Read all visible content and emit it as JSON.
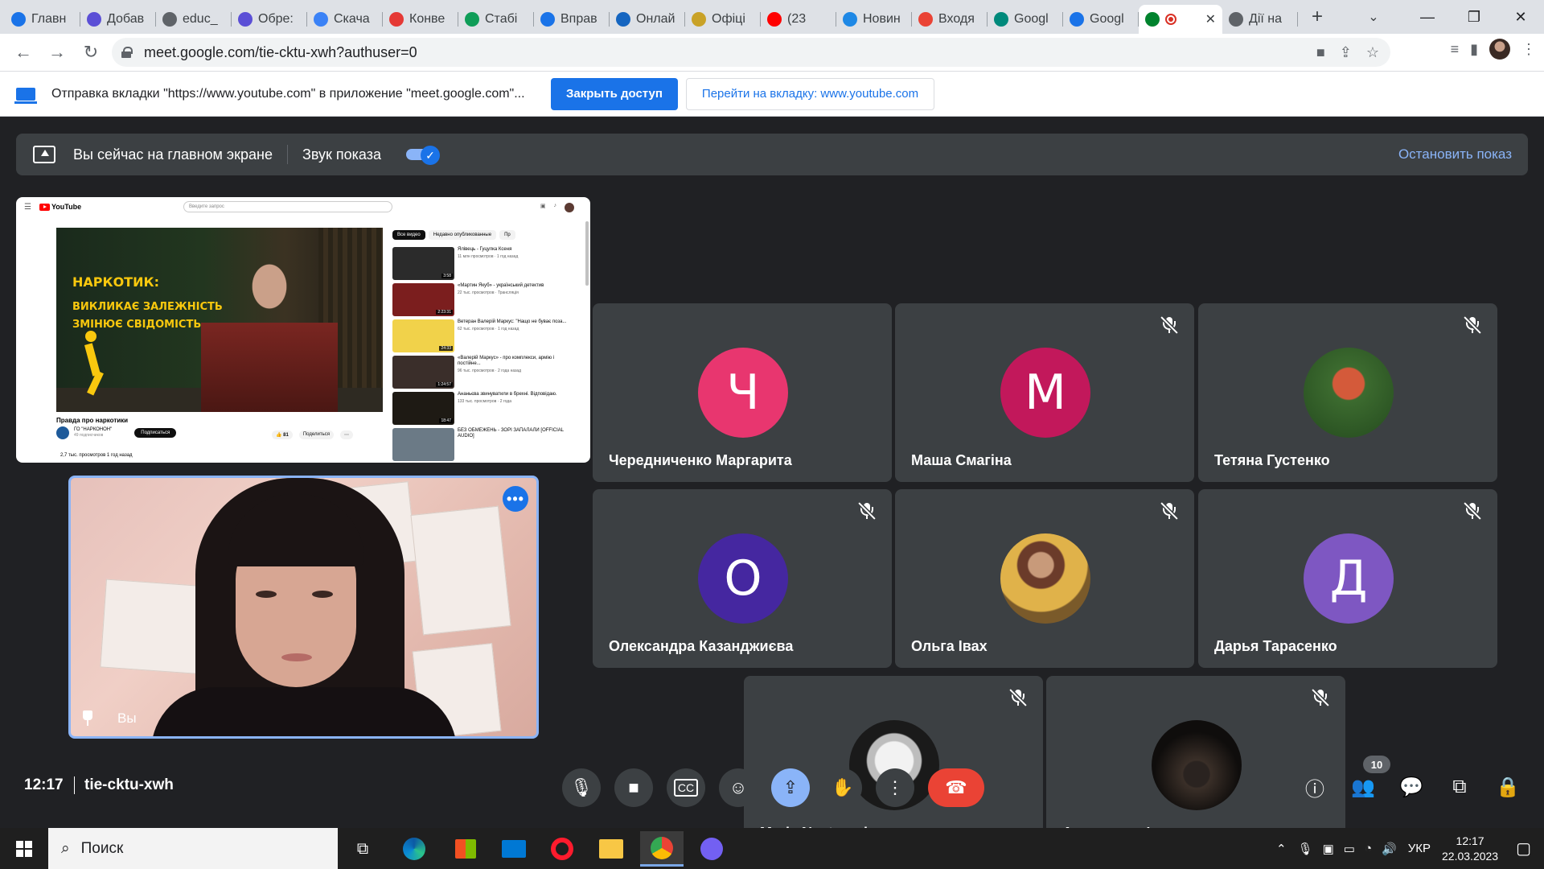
{
  "browser": {
    "tabs": [
      {
        "label": "Главн",
        "icon": "chrome-app-icon",
        "color": "#1a73e8"
      },
      {
        "label": "Добав",
        "icon": "shield-icon",
        "color": "#5b4fd6"
      },
      {
        "label": "educ_",
        "icon": "globe-icon",
        "color": "#5f6368"
      },
      {
        "label": "Обре:",
        "icon": "shield-icon",
        "color": "#5b4fd6"
      },
      {
        "label": "Скача",
        "icon": "thumbs-icon",
        "color": "#3b82f6"
      },
      {
        "label": "Конве",
        "icon": "heart-icon",
        "color": "#e53935"
      },
      {
        "label": "Стабі",
        "icon": "chart-icon",
        "color": "#0f9d58"
      },
      {
        "label": "Вправ",
        "icon": "a-icon",
        "color": "#1a73e8"
      },
      {
        "label": "Онлай",
        "icon": "online-icon",
        "color": "#1565c0"
      },
      {
        "label": "Офіці",
        "icon": "emblem-icon",
        "color": "#c9a227"
      },
      {
        "label": "(23",
        "icon": "youtube-icon",
        "color": "#ff0000"
      },
      {
        "label": "Новин",
        "icon": "snowflake-icon",
        "color": "#1e88e5"
      },
      {
        "label": "Входя",
        "icon": "gmail-icon",
        "color": "#ea4335"
      },
      {
        "label": "Googl",
        "icon": "google-meet-icon",
        "color": "#00897b"
      },
      {
        "label": "Googl",
        "icon": "calendar-icon",
        "color": "#1a73e8"
      },
      {
        "label": "",
        "icon": "meet-icon",
        "color": "#00832d",
        "active": true
      },
      {
        "label": "Дії на",
        "icon": "globe-icon",
        "color": "#5f6368"
      }
    ],
    "url": "meet.google.com/tie-cktu-xwh?authuser=0",
    "infobar": {
      "text": "Отправка вкладки \"https://www.youtube.com\" в приложение \"meet.google.com\"...",
      "close_access": "Закрыть доступ",
      "go_to_tab": "Перейти на вкладку: www.youtube.com"
    }
  },
  "meet": {
    "presenting_banner": {
      "text": "Вы сейчас на главном экране",
      "audio_label": "Звук показа",
      "audio_on": true,
      "stop_label": "Остановить показ"
    },
    "shared_screen": {
      "site": "YouTube",
      "search_placeholder": "Введите запрос",
      "video_title": "Правда про наркотики",
      "overlay_line1": "НАРКОТИК:",
      "overlay_line2": "ВИКЛИКАЄ ЗАЛЕЖНІСТЬ\nЗМІНЮЄ СВІДОМІСТЬ",
      "channel": "ГО \"НАРКОНОН\"",
      "subscribers": "49 подписчиков",
      "subscribe": "Подписаться",
      "likes": "81",
      "share": "Поделиться",
      "views": "2,7 тыс. просмотров  1 год назад",
      "chips": [
        "Все видео",
        "Недавно опубликованные",
        "Пр"
      ],
      "suggestions": [
        {
          "title": "Ялівець - Гуцулка Ксеня",
          "meta": "11 млн просмотров · 1 год назад",
          "duration": "3:58",
          "color": "#2b2b2b"
        },
        {
          "title": "«Мартин Якуб» - український детектив",
          "meta": "22 тыс. просмотров · Трансляція",
          "duration": "2:23:31",
          "color": "#7b1e1e"
        },
        {
          "title": "Ветеран Валерій Маркус: \"Нащо не буває поза...",
          "meta": "62 тыс. просмотров · 1 год назад",
          "duration": "24:33",
          "color": "#f1d24a"
        },
        {
          "title": "«Валерій Маркус» - про комплекси, армію і постійне...",
          "meta": "96 тыс. просмотров · 2 года назад",
          "duration": "1:24:57",
          "color": "#3a2e2a"
        },
        {
          "title": "Ананьєва звинуватили в брехні. Відповідаю.",
          "meta": "133 тыс. просмотров · 2 года",
          "duration": "18:47",
          "color": "#1e1a14"
        },
        {
          "title": "БЕЗ ОБМЕЖЕНЬ - ЗОРІ ЗАПАЛАЛИ [OFFICIAL AUDIO]",
          "meta": "",
          "duration": "",
          "color": "#6b7a86"
        }
      ]
    },
    "self_view": {
      "label": "Вы"
    },
    "participants": [
      {
        "name": "Чередниченко Маргарита",
        "initial": "Ч",
        "color": "#e8366f",
        "muted": false
      },
      {
        "name": "Маша Смагіна",
        "initial": "М",
        "color": "#c2185b",
        "muted": true
      },
      {
        "name": "Тетяна Густенко",
        "initial": "",
        "color": "#2e5e2a",
        "muted": true,
        "photo": true
      },
      {
        "name": "Олександра Казанджиєва",
        "initial": "О",
        "color": "#4527a0",
        "muted": true
      },
      {
        "name": "Ольга Івах",
        "initial": "",
        "color": "#8a6a3a",
        "muted": true,
        "photo": true
      },
      {
        "name": "Дарья Тарасенко",
        "initial": "Д",
        "color": "#7e57c2",
        "muted": true
      },
      {
        "name": "Maria Nesterenko",
        "initial": "",
        "color": "#2a2a2a",
        "muted": true,
        "photo": true
      },
      {
        "name": "Анастасия Фаренюк",
        "initial": "",
        "color": "#1d1a18",
        "muted": true,
        "photo": true
      }
    ],
    "time": "12:17",
    "meeting_code": "tie-cktu-xwh",
    "participant_count": "10"
  },
  "taskbar": {
    "search_placeholder": "Поиск",
    "language": "УКР",
    "time": "12:17",
    "date": "22.03.2023"
  }
}
